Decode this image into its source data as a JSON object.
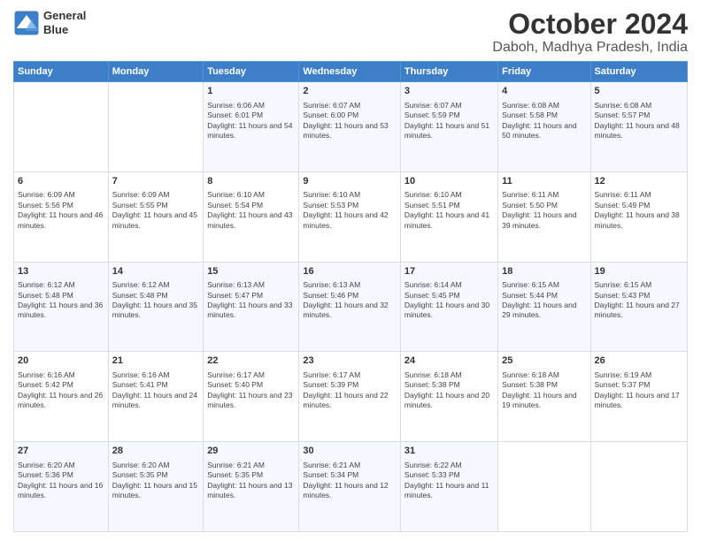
{
  "logo": {
    "line1": "General",
    "line2": "Blue"
  },
  "title": "October 2024",
  "subtitle": "Daboh, Madhya Pradesh, India",
  "days_of_week": [
    "Sunday",
    "Monday",
    "Tuesday",
    "Wednesday",
    "Thursday",
    "Friday",
    "Saturday"
  ],
  "weeks": [
    [
      {
        "day": "",
        "sunrise": "",
        "sunset": "",
        "daylight": ""
      },
      {
        "day": "",
        "sunrise": "",
        "sunset": "",
        "daylight": ""
      },
      {
        "day": "1",
        "sunrise": "Sunrise: 6:06 AM",
        "sunset": "Sunset: 6:01 PM",
        "daylight": "Daylight: 11 hours and 54 minutes."
      },
      {
        "day": "2",
        "sunrise": "Sunrise: 6:07 AM",
        "sunset": "Sunset: 6:00 PM",
        "daylight": "Daylight: 11 hours and 53 minutes."
      },
      {
        "day": "3",
        "sunrise": "Sunrise: 6:07 AM",
        "sunset": "Sunset: 5:59 PM",
        "daylight": "Daylight: 11 hours and 51 minutes."
      },
      {
        "day": "4",
        "sunrise": "Sunrise: 6:08 AM",
        "sunset": "Sunset: 5:58 PM",
        "daylight": "Daylight: 11 hours and 50 minutes."
      },
      {
        "day": "5",
        "sunrise": "Sunrise: 6:08 AM",
        "sunset": "Sunset: 5:57 PM",
        "daylight": "Daylight: 11 hours and 48 minutes."
      }
    ],
    [
      {
        "day": "6",
        "sunrise": "Sunrise: 6:09 AM",
        "sunset": "Sunset: 5:56 PM",
        "daylight": "Daylight: 11 hours and 46 minutes."
      },
      {
        "day": "7",
        "sunrise": "Sunrise: 6:09 AM",
        "sunset": "Sunset: 5:55 PM",
        "daylight": "Daylight: 11 hours and 45 minutes."
      },
      {
        "day": "8",
        "sunrise": "Sunrise: 6:10 AM",
        "sunset": "Sunset: 5:54 PM",
        "daylight": "Daylight: 11 hours and 43 minutes."
      },
      {
        "day": "9",
        "sunrise": "Sunrise: 6:10 AM",
        "sunset": "Sunset: 5:53 PM",
        "daylight": "Daylight: 11 hours and 42 minutes."
      },
      {
        "day": "10",
        "sunrise": "Sunrise: 6:10 AM",
        "sunset": "Sunset: 5:51 PM",
        "daylight": "Daylight: 11 hours and 41 minutes."
      },
      {
        "day": "11",
        "sunrise": "Sunrise: 6:11 AM",
        "sunset": "Sunset: 5:50 PM",
        "daylight": "Daylight: 11 hours and 39 minutes."
      },
      {
        "day": "12",
        "sunrise": "Sunrise: 6:11 AM",
        "sunset": "Sunset: 5:49 PM",
        "daylight": "Daylight: 11 hours and 38 minutes."
      }
    ],
    [
      {
        "day": "13",
        "sunrise": "Sunrise: 6:12 AM",
        "sunset": "Sunset: 5:48 PM",
        "daylight": "Daylight: 11 hours and 36 minutes."
      },
      {
        "day": "14",
        "sunrise": "Sunrise: 6:12 AM",
        "sunset": "Sunset: 5:48 PM",
        "daylight": "Daylight: 11 hours and 35 minutes."
      },
      {
        "day": "15",
        "sunrise": "Sunrise: 6:13 AM",
        "sunset": "Sunset: 5:47 PM",
        "daylight": "Daylight: 11 hours and 33 minutes."
      },
      {
        "day": "16",
        "sunrise": "Sunrise: 6:13 AM",
        "sunset": "Sunset: 5:46 PM",
        "daylight": "Daylight: 11 hours and 32 minutes."
      },
      {
        "day": "17",
        "sunrise": "Sunrise: 6:14 AM",
        "sunset": "Sunset: 5:45 PM",
        "daylight": "Daylight: 11 hours and 30 minutes."
      },
      {
        "day": "18",
        "sunrise": "Sunrise: 6:15 AM",
        "sunset": "Sunset: 5:44 PM",
        "daylight": "Daylight: 11 hours and 29 minutes."
      },
      {
        "day": "19",
        "sunrise": "Sunrise: 6:15 AM",
        "sunset": "Sunset: 5:43 PM",
        "daylight": "Daylight: 11 hours and 27 minutes."
      }
    ],
    [
      {
        "day": "20",
        "sunrise": "Sunrise: 6:16 AM",
        "sunset": "Sunset: 5:42 PM",
        "daylight": "Daylight: 11 hours and 26 minutes."
      },
      {
        "day": "21",
        "sunrise": "Sunrise: 6:16 AM",
        "sunset": "Sunset: 5:41 PM",
        "daylight": "Daylight: 11 hours and 24 minutes."
      },
      {
        "day": "22",
        "sunrise": "Sunrise: 6:17 AM",
        "sunset": "Sunset: 5:40 PM",
        "daylight": "Daylight: 11 hours and 23 minutes."
      },
      {
        "day": "23",
        "sunrise": "Sunrise: 6:17 AM",
        "sunset": "Sunset: 5:39 PM",
        "daylight": "Daylight: 11 hours and 22 minutes."
      },
      {
        "day": "24",
        "sunrise": "Sunrise: 6:18 AM",
        "sunset": "Sunset: 5:38 PM",
        "daylight": "Daylight: 11 hours and 20 minutes."
      },
      {
        "day": "25",
        "sunrise": "Sunrise: 6:18 AM",
        "sunset": "Sunset: 5:38 PM",
        "daylight": "Daylight: 11 hours and 19 minutes."
      },
      {
        "day": "26",
        "sunrise": "Sunrise: 6:19 AM",
        "sunset": "Sunset: 5:37 PM",
        "daylight": "Daylight: 11 hours and 17 minutes."
      }
    ],
    [
      {
        "day": "27",
        "sunrise": "Sunrise: 6:20 AM",
        "sunset": "Sunset: 5:36 PM",
        "daylight": "Daylight: 11 hours and 16 minutes."
      },
      {
        "day": "28",
        "sunrise": "Sunrise: 6:20 AM",
        "sunset": "Sunset: 5:35 PM",
        "daylight": "Daylight: 11 hours and 15 minutes."
      },
      {
        "day": "29",
        "sunrise": "Sunrise: 6:21 AM",
        "sunset": "Sunset: 5:35 PM",
        "daylight": "Daylight: 11 hours and 13 minutes."
      },
      {
        "day": "30",
        "sunrise": "Sunrise: 6:21 AM",
        "sunset": "Sunset: 5:34 PM",
        "daylight": "Daylight: 11 hours and 12 minutes."
      },
      {
        "day": "31",
        "sunrise": "Sunrise: 6:22 AM",
        "sunset": "Sunset: 5:33 PM",
        "daylight": "Daylight: 11 hours and 11 minutes."
      },
      {
        "day": "",
        "sunrise": "",
        "sunset": "",
        "daylight": ""
      },
      {
        "day": "",
        "sunrise": "",
        "sunset": "",
        "daylight": ""
      }
    ]
  ]
}
